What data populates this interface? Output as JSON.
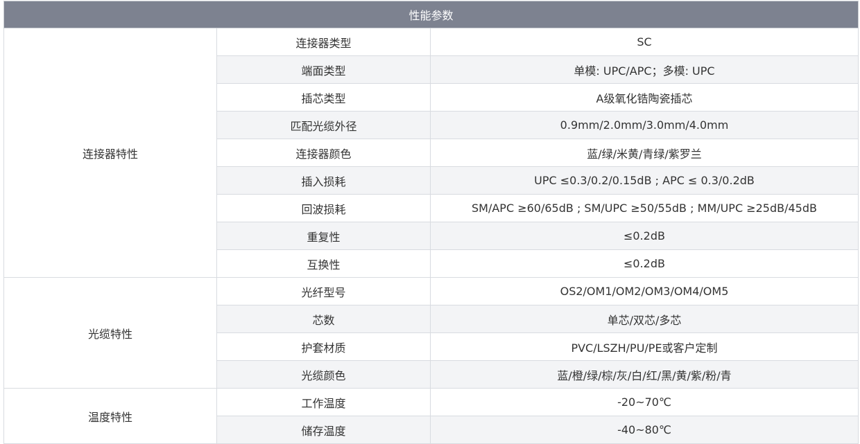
{
  "table": {
    "header": "性能参数",
    "groups": [
      {
        "category": "连接器特性",
        "rows": [
          {
            "name": "连接器类型",
            "value": "SC"
          },
          {
            "name": "端面类型",
            "value": "单模: UPC/APC；多模: UPC"
          },
          {
            "name": "插芯类型",
            "value": "A级氧化锆陶瓷插芯"
          },
          {
            "name": "匹配光缆外径",
            "value": "0.9mm/2.0mm/3.0mm/4.0mm"
          },
          {
            "name": "连接器颜色",
            "value": "蓝/绿/米黄/青绿/紫罗兰"
          },
          {
            "name": "插入损耗",
            "value": "UPC ≤0.3/0.2/0.15dB ; APC ≤  0.3/0.2dB"
          },
          {
            "name": "回波损耗",
            "value": "SM/APC ≥60/65dB ; SM/UPC ≥50/55dB ; MM/UPC ≥25dB/45dB"
          },
          {
            "name": "重复性",
            "value": "≤0.2dB"
          },
          {
            "name": "互换性",
            "value": "≤0.2dB"
          }
        ]
      },
      {
        "category": "光缆特性",
        "rows": [
          {
            "name": "光纤型号",
            "value": "OS2/OM1/OM2/OM3/OM4/OM5"
          },
          {
            "name": "芯数",
            "value": "单芯/双芯/多芯"
          },
          {
            "name": "护套材质",
            "value": "PVC/LSZH/PU/PE或客户定制"
          },
          {
            "name": "光缆颜色",
            "value": "蓝/橙/绿/棕/灰/白/红/黑/黄/紫/粉/青"
          }
        ]
      },
      {
        "category": "温度特性",
        "rows": [
          {
            "name": "工作温度",
            "value": "-20~70℃"
          },
          {
            "name": "储存温度",
            "value": "-40~80℃"
          }
        ]
      }
    ]
  },
  "colors": {
    "header_bg": "#7d8290",
    "header_text": "#ffffff",
    "stripe_bg": "#f3f4f6",
    "border": "#d8dbe0",
    "text": "#333333"
  }
}
